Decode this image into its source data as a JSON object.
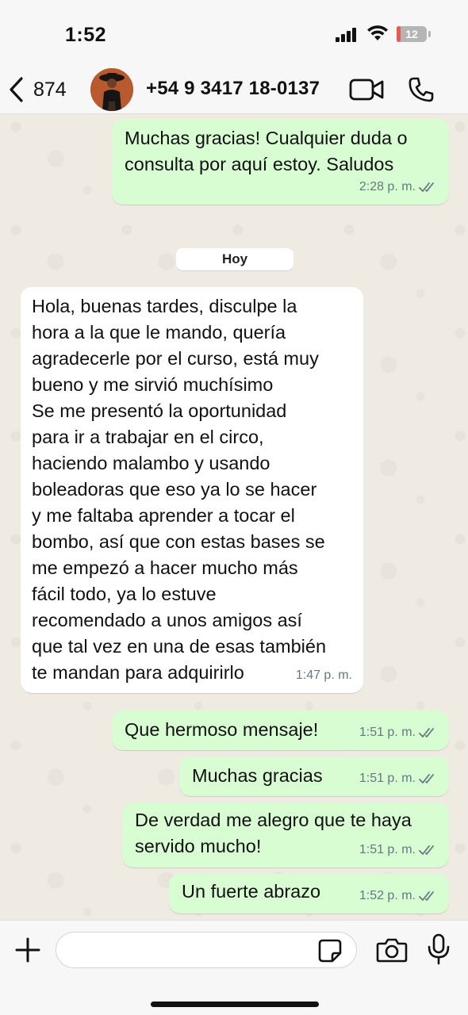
{
  "status_bar": {
    "time": "1:52",
    "battery_level": "12",
    "battery_color": "#e35b52"
  },
  "header": {
    "back_count": "874",
    "contact_name": "+54 9 3417 18-0137",
    "icons": [
      "chevron-left-icon",
      "video-camera-icon",
      "phone-icon"
    ]
  },
  "chat": {
    "date_divider": "Hoy",
    "messages": [
      {
        "direction": "outgoing",
        "text": "Muchas gracias! Cualquier duda o\nconsulta por aquí estoy. Saludos",
        "time": "2:28 p. m.",
        "status": "read"
      },
      {
        "direction": "incoming",
        "text": "Hola, buenas tardes, disculpe la\nhora a la que le mando, quería\nagradecerle por el curso, está muy\nbueno y me sirvió muchísimo\nSe me presentó la oportunidad\npara ir a trabajar en el circo,\nhaciendo malambo y usando\nboleadoras que eso ya lo se hacer\ny me faltaba aprender a tocar el\nbombo, así que con estas bases se\nme empezó a hacer mucho más\nfácil todo, ya lo estuve\nrecomendado a unos amigos así\nque tal vez en una de esas también\nte mandan para adquirirlo",
        "time": "1:47 p. m."
      },
      {
        "direction": "outgoing",
        "text": "Que hermoso mensaje!",
        "time": "1:51 p. m.",
        "status": "read"
      },
      {
        "direction": "outgoing",
        "text": "Muchas gracias",
        "time": "1:51 p. m.",
        "status": "read"
      },
      {
        "direction": "outgoing",
        "text": "De verdad me alegro que te haya\nservido mucho!",
        "time": "1:51 p. m.",
        "status": "read"
      },
      {
        "direction": "outgoing",
        "text": "Un fuerte abrazo",
        "time": "1:52 p. m.",
        "status": "read"
      }
    ]
  },
  "composer": {
    "input_value": "",
    "icons": [
      "plus-icon",
      "sticker-icon",
      "camera-icon",
      "microphone-icon"
    ]
  },
  "colors": {
    "outgoing_bubble": "#d9fdd3",
    "incoming_bubble": "#ffffff",
    "wallpaper": "#efeae2",
    "read_ticks": "#667781"
  }
}
